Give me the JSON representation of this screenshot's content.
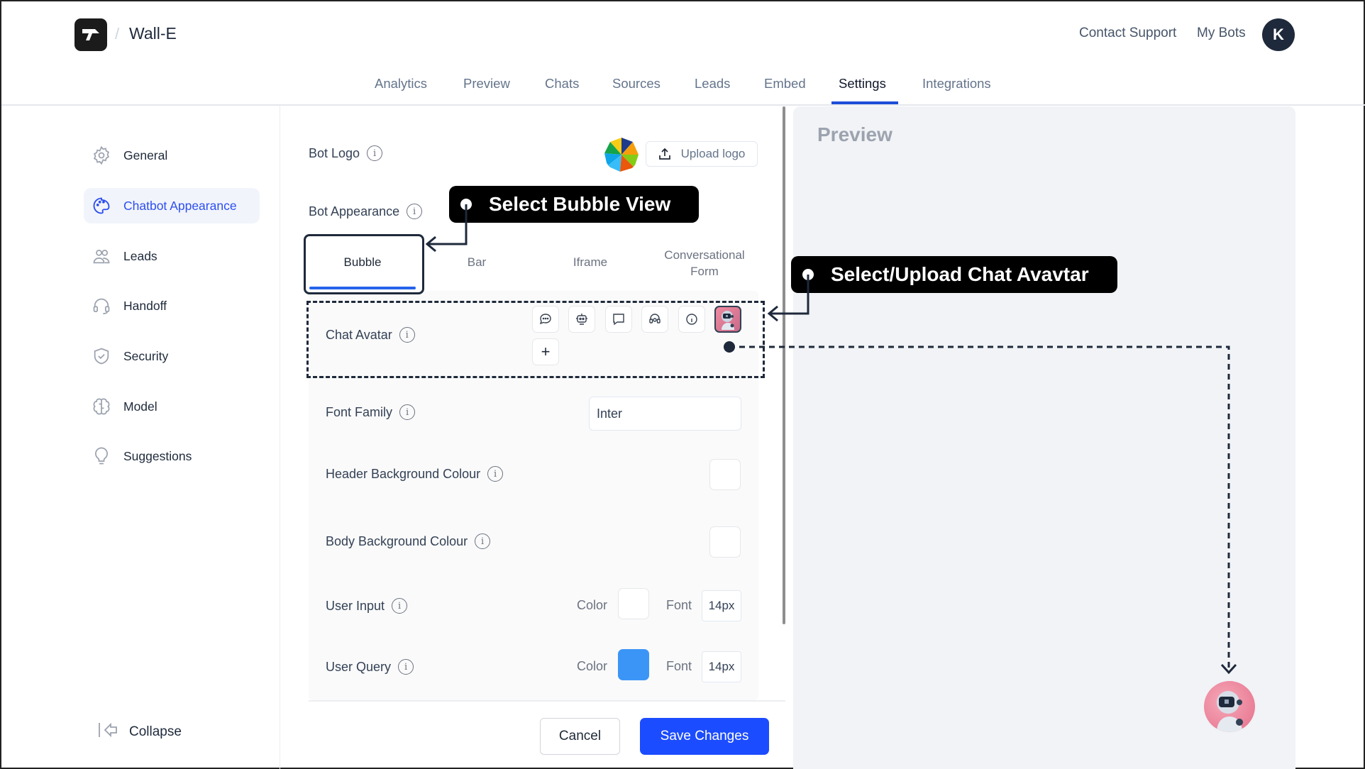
{
  "header": {
    "brand_icon": "brand-logo-icon",
    "separator": "/",
    "bot_name": "Wall-E",
    "links": [
      "Contact Support",
      "My Bots"
    ],
    "user_initial": "K"
  },
  "nav_tabs": [
    {
      "label": "Analytics",
      "active": false
    },
    {
      "label": "Preview",
      "active": false
    },
    {
      "label": "Chats",
      "active": false
    },
    {
      "label": "Sources",
      "active": false
    },
    {
      "label": "Leads",
      "active": false
    },
    {
      "label": "Embed",
      "active": false
    },
    {
      "label": "Settings",
      "active": true
    },
    {
      "label": "Integrations",
      "active": false
    }
  ],
  "sidebar": {
    "items": [
      {
        "label": "General",
        "icon": "gear-icon",
        "active": false
      },
      {
        "label": "Chatbot Appearance",
        "icon": "palette-icon",
        "active": true
      },
      {
        "label": "Leads",
        "icon": "users-icon",
        "active": false
      },
      {
        "label": "Handoff",
        "icon": "headset-icon",
        "active": false
      },
      {
        "label": "Security",
        "icon": "shield-check-icon",
        "active": false
      },
      {
        "label": "Model",
        "icon": "brain-icon",
        "active": false
      },
      {
        "label": "Suggestions",
        "icon": "lightbulb-icon",
        "active": false
      }
    ],
    "collapse_label": "Collapse"
  },
  "settings": {
    "bot_logo_label": "Bot Logo",
    "upload_logo_label": "Upload logo",
    "bot_appearance_label": "Bot Appearance",
    "view_tabs": [
      {
        "label": "Bubble",
        "active": true
      },
      {
        "label": "Bar",
        "active": false
      },
      {
        "label": "Iframe",
        "active": false
      },
      {
        "label": "Conversational Form",
        "active": false
      }
    ],
    "chat_avatar_label": "Chat Avatar",
    "avatar_options": [
      "chat-dots-icon",
      "robot-icon",
      "message-square-icon",
      "headset-icon",
      "info-icon",
      "robot-avatar-image"
    ],
    "selected_avatar": "robot-avatar-image",
    "add_avatar_label": "+",
    "font_family_label": "Font Family",
    "font_family_value": "Inter",
    "header_bg_label": "Header Background Colour",
    "header_bg_color": "#ffffff",
    "body_bg_label": "Body Background Colour",
    "body_bg_color": "#ffffff",
    "user_input": {
      "label": "User Input",
      "color_label": "Color",
      "color": "#ffffff",
      "font_label": "Font",
      "font_size": "14px"
    },
    "user_query": {
      "label": "User Query",
      "color_label": "Color",
      "color": "#3b95f7",
      "font_label": "Font",
      "font_size": "14px"
    },
    "cancel_label": "Cancel",
    "save_label": "Save Changes"
  },
  "preview": {
    "title": "Preview"
  },
  "annotations": {
    "callout_bubble": "Select Bubble View",
    "callout_avatar": "Select/Upload Chat Avavtar"
  },
  "colors": {
    "accent": "#1c4cff",
    "sidebar_active_text": "#2e4ef0",
    "tab_underline": "#1d4ed8",
    "preview_bg": "#f1f3f6"
  }
}
